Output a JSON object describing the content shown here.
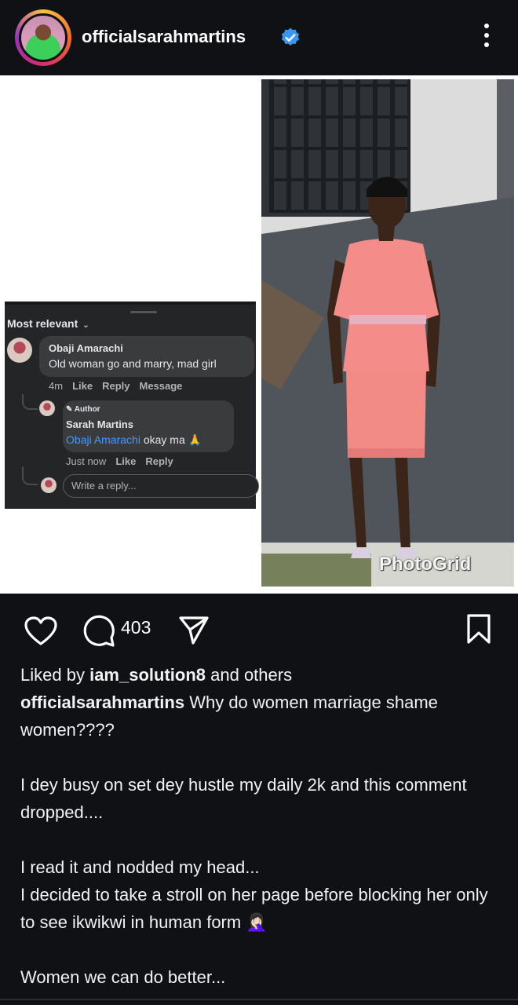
{
  "header": {
    "username": "officialsarahmartins",
    "verified_icon": "verified-badge-icon",
    "more_icon": "more-vertical-icon"
  },
  "post_image": {
    "comment_screenshot": {
      "sort_label": "Most relevant",
      "comment": {
        "name": "Obaji Amarachi",
        "text": "Old woman go and marry, mad girl",
        "time": "4m",
        "like": "Like",
        "reply": "Reply",
        "message": "Message"
      },
      "reply": {
        "author_tag": "Author",
        "name": "Sarah Martins",
        "mention": "Obaji Amarachi",
        "text": "okay ma 🙏",
        "time": "Just now",
        "like": "Like",
        "reply": "Reply"
      },
      "input_placeholder": "Write a reply..."
    },
    "watermark": "PhotoGrid"
  },
  "actions": {
    "like_icon": "heart-icon",
    "comment_icon": "comment-icon",
    "comment_count": "403",
    "share_icon": "send-icon",
    "save_icon": "bookmark-icon"
  },
  "caption": {
    "liked_prefix": "Liked by",
    "liked_user": "iam_solution8",
    "liked_suffix": "and others",
    "user": "officialsarahmartins",
    "line1": "Why do women marriage shame women????",
    "line2": "I dey busy on set dey hustle my daily 2k and this comment dropped....",
    "line3": "I read it and nodded my head...",
    "line4": "I decided to take a stroll on her page before blocking her only to see ikwikwi in human form 🤦🏻‍♀️",
    "line5": "Women we can do better..."
  },
  "colors": {
    "background": "#0f1115",
    "link_blue": "#4599ff",
    "verified_blue": "#3897f0"
  }
}
